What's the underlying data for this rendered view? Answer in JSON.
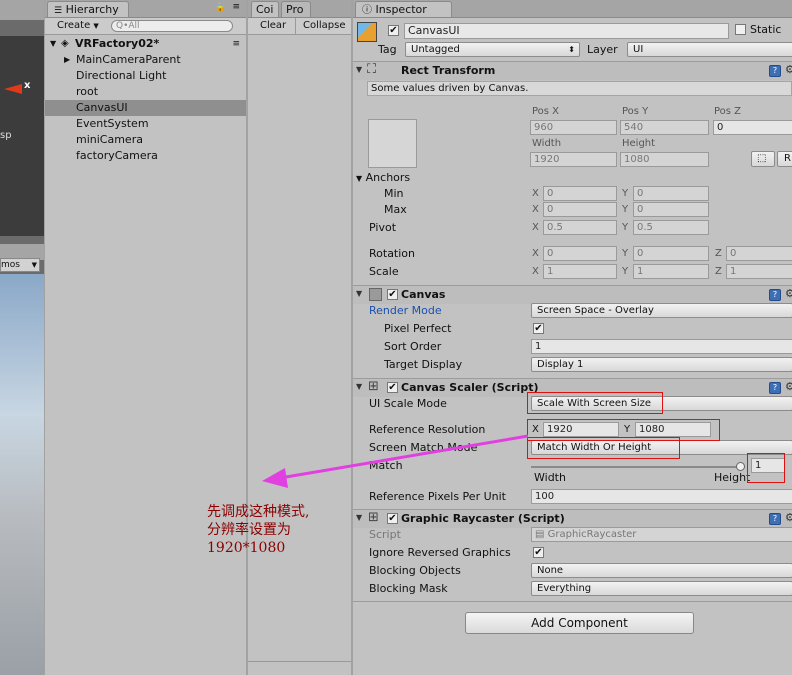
{
  "scene": {
    "tab_fragment": "sp",
    "gizmos_label": "mos"
  },
  "hierarchy": {
    "tab_label": "Hierarchy",
    "create_label": "Create",
    "search_placeholder": "Q•All",
    "scene_name": "VRFactory02*",
    "items": [
      {
        "label": "MainCameraParent"
      },
      {
        "label": "Directional Light"
      },
      {
        "label": "root"
      },
      {
        "label": "CanvasUI"
      },
      {
        "label": "EventSystem"
      },
      {
        "label": "miniCamera"
      },
      {
        "label": "factoryCamera"
      }
    ]
  },
  "console": {
    "tab1": "Coi",
    "tab2": "Pro",
    "clear_label": "Clear",
    "collapse_label": "Collapse"
  },
  "inspector": {
    "tab_label": "Inspector",
    "object_name": "CanvasUI",
    "static_label": "Static",
    "tag_label": "Tag",
    "tag_value": "Untagged",
    "layer_label": "Layer",
    "layer_value": "UI",
    "rect": {
      "title": "Rect Transform",
      "note": "Some values driven by Canvas.",
      "posx_label": "Pos X",
      "posy_label": "Pos Y",
      "posz_label": "Pos Z",
      "posx": "960",
      "posy": "540",
      "posz": "0",
      "width_label": "Width",
      "height_label": "Height",
      "width": "1920",
      "height": "1080",
      "r_label": "R",
      "anchors_label": "Anchors",
      "min_label": "Min",
      "max_label": "Max",
      "pivot_label": "Pivot",
      "x_label": "X",
      "y_label": "Y",
      "z_label": "Z",
      "min_x": "0",
      "min_y": "0",
      "max_x": "0",
      "max_y": "0",
      "pivot_x": "0.5",
      "pivot_y": "0.5",
      "rotation_label": "Rotation",
      "rot_x": "0",
      "rot_y": "0",
      "rot_z": "0",
      "scale_label": "Scale",
      "scale_x": "1",
      "scale_y": "1",
      "scale_z": "1"
    },
    "canvas": {
      "title": "Canvas",
      "render_mode_label": "Render Mode",
      "render_mode": "Screen Space - Overlay",
      "pixel_perfect_label": "Pixel Perfect",
      "pixel_perfect": "✔",
      "sort_order_label": "Sort Order",
      "sort_order": "1",
      "target_display_label": "Target Display",
      "target_display": "Display 1"
    },
    "scaler": {
      "title": "Canvas Scaler (Script)",
      "ui_scale_mode_label": "UI Scale Mode",
      "ui_scale_mode": "Scale With Screen Size",
      "ref_res_label": "Reference Resolution",
      "ref_x": "1920",
      "ref_y": "1080",
      "match_mode_label": "Screen Match Mode",
      "match_mode": "Match Width Or Height",
      "match_label": "Match",
      "match_value": "1",
      "match_fraction": 1,
      "width_label": "Width",
      "height_label": "Height",
      "ref_ppu_label": "Reference Pixels Per Unit",
      "ref_ppu": "100"
    },
    "raycaster": {
      "title": "Graphic Raycaster (Script)",
      "script_label": "Script",
      "script_value": "GraphicRaycaster",
      "ignore_reversed_label": "Ignore Reversed Graphics",
      "ignore_reversed": "✔",
      "blocking_objects_label": "Blocking Objects",
      "blocking_objects": "None",
      "blocking_mask_label": "Blocking Mask",
      "blocking_mask": "Everything"
    },
    "add_component_label": "Add Component"
  },
  "annotation": {
    "line1": "先调成这种模式,",
    "line2": "分辨率设置为",
    "line3": "1920*1080",
    "color": "#8b0000",
    "arrow_color": "#e040e0",
    "box_color": "#e01010"
  },
  "colors": {
    "link_blue": "#1a4fb0",
    "selection": "#8f8f8f"
  }
}
